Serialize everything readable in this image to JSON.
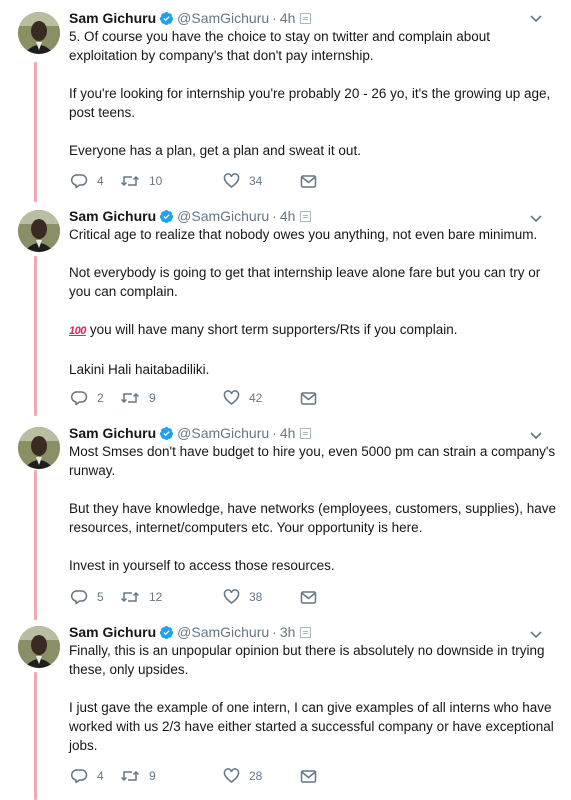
{
  "tweets": [
    {
      "name": "Sam Gichuru",
      "handle": "@SamGichuru",
      "dot": "·",
      "time": "4h",
      "paragraphs": [
        "5. Of course you have the choice to stay on twitter and complain about exploitation by company's that don't pay internship.",
        "If you're looking for internship you're probably 20 - 26 yo, it's the growing up age, post teens.",
        "Everyone has a plan, get a plan and sweat it out."
      ],
      "replies": "4",
      "retweets": "10",
      "likes": "34"
    },
    {
      "name": "Sam Gichuru",
      "handle": "@SamGichuru",
      "dot": "·",
      "time": "4h",
      "paragraphs": [
        "Critical age to realize that nobody owes you anything, not even bare minimum.",
        "Not everybody is going to get that internship leave alone fare but you can try or you can complain.",
        "you will have many short term supporters/Rts if you complain.",
        "Lakini Hali haitabadiliki."
      ],
      "emoji": "100",
      "replies": "2",
      "retweets": "9",
      "likes": "42"
    },
    {
      "name": "Sam Gichuru",
      "handle": "@SamGichuru",
      "dot": "·",
      "time": "4h",
      "paragraphs": [
        "Most Smses don't have budget to hire you, even 5000 pm can strain a company's runway.",
        "But they have knowledge, have networks (employees, customers, supplies), have resources, internet/computers etc. Your opportunity is here.",
        "Invest in yourself to access those resources."
      ],
      "replies": "5",
      "retweets": "12",
      "likes": "38"
    },
    {
      "name": "Sam Gichuru",
      "handle": "@SamGichuru",
      "dot": "·",
      "time": "3h",
      "paragraphs": [
        "Finally, this is an unpopular opinion but there is absolutely no downside in trying these, only upsides.",
        "I just gave the example of one intern, I can give examples of all interns who have worked with us 2/3 have either started a successful company or have exceptional jobs."
      ],
      "replies": "4",
      "retweets": "9",
      "likes": "28"
    }
  ],
  "colors": {
    "thread_line": "#f3a9b2",
    "verified": "#1da1f2",
    "secondary_text": "#657786"
  },
  "icons": [
    "verified-badge-icon",
    "message-icon",
    "chevron-down-icon",
    "reply-icon",
    "retweet-icon",
    "like-icon",
    "direct-message-icon"
  ]
}
